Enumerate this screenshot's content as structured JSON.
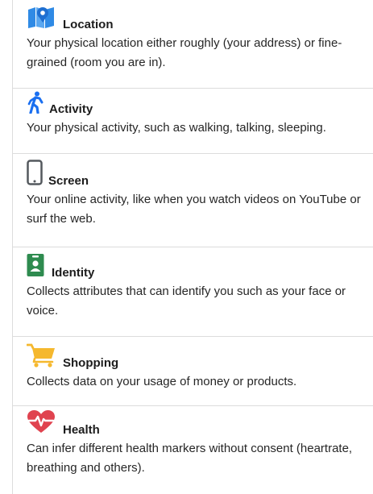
{
  "items": [
    {
      "title": "Location",
      "description": "Your physical location either roughly (your address) or fine-grained (room you are in).",
      "icon": "map-icon",
      "color": "#2f8ae5"
    },
    {
      "title": "Activity",
      "description": "Your physical activity, such as walking, talking, sleeping.",
      "icon": "walking-person-icon",
      "color": "#1a6ff0"
    },
    {
      "title": "Screen",
      "description": "Your online activity, like when you watch videos on YouTube or surf the web.",
      "icon": "smartphone-icon",
      "color": "#54595e"
    },
    {
      "title": "Identity",
      "description": "Collects attributes that can identify you such as your face or voice.",
      "icon": "id-badge-icon",
      "color": "#2e8b4f"
    },
    {
      "title": "Shopping",
      "description": "Collects data on your usage of money or products.",
      "icon": "shopping-cart-icon",
      "color": "#f5b82e"
    },
    {
      "title": "Health",
      "description": "Can infer different health markers without consent (heartrate, breathing and others).",
      "icon": "heartbeat-icon",
      "color": "#e0434f"
    }
  ]
}
